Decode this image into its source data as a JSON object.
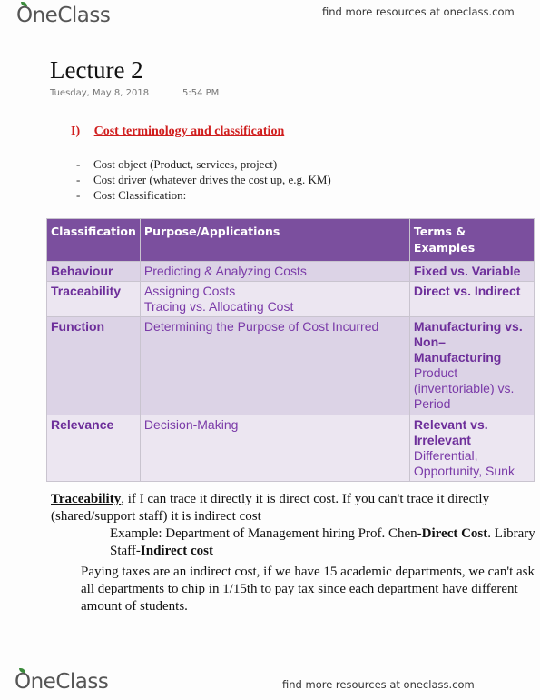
{
  "header": {
    "logo": "OneClass",
    "tagline": "find more resources at oneclass.com"
  },
  "note": {
    "title": "Lecture 2",
    "date": "Tuesday, May 8, 2018",
    "time": "5:54 PM"
  },
  "section": {
    "number": "I)",
    "heading": "Cost terminology and classification"
  },
  "bullets": [
    {
      "dash": "-",
      "text": "Cost object (Product, services, project)"
    },
    {
      "dash": "-",
      "text": "Cost driver (whatever drives the cost up, e.g. KM)"
    },
    {
      "dash": "-",
      "text": "Cost Classification:"
    }
  ],
  "table": {
    "headers": [
      "Classification",
      "Purpose/Applications",
      "Terms & Examples"
    ],
    "rows": [
      {
        "classification": "Behaviour",
        "purpose": [
          "Predicting & Analyzing Costs"
        ],
        "terms_bold": "Fixed vs. Variable",
        "terms_normal": ""
      },
      {
        "classification": "Traceability",
        "purpose": [
          "Assigning Costs",
          "Tracing vs. Allocating Cost"
        ],
        "terms_bold": "Direct vs. Indirect",
        "terms_normal": ""
      },
      {
        "classification": "Function",
        "purpose": [
          "Determining the Purpose of Cost Incurred"
        ],
        "terms_bold": "Manufacturing vs. Non– Manufacturing",
        "terms_normal": "Product (inventoriable) vs. Period"
      },
      {
        "classification": "Relevance",
        "purpose": [
          "Decision-Making"
        ],
        "terms_bold": "Relevant vs. Irrelevant",
        "terms_normal": "Differential, Opportunity, Sunk"
      }
    ]
  },
  "body": {
    "p1_keyword": "Traceability",
    "p1_rest": ", if I can trace it directly it is direct cost. If you can't trace it directly (shared/support staff) it is indirect cost",
    "p2_a": "Example: Department of Management hiring Prof. Chen-",
    "p2_b": "Direct Cost",
    "p2_c": ". Library Staff-",
    "p2_d": "Indirect cost",
    "p3": "Paying taxes are an indirect cost, if we have 15 academic departments, we can't ask all departments to chip in 1/15th to pay tax since each department have different amount of students."
  },
  "footer": {
    "logo": "OneClass",
    "tagline": "find more resources at oneclass.com"
  }
}
